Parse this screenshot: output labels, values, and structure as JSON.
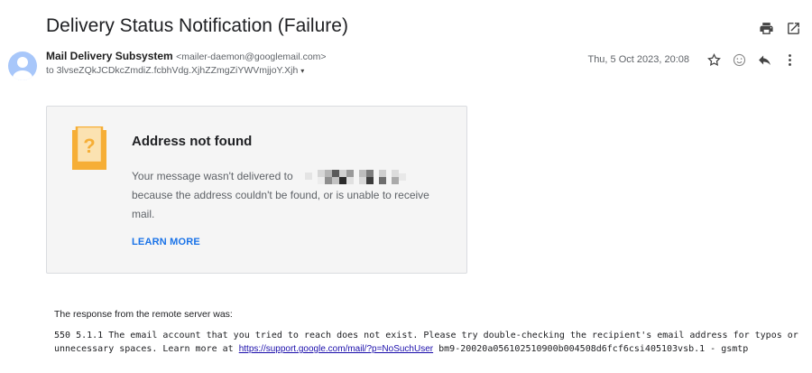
{
  "email": {
    "subject": "Delivery Status Notification (Failure)",
    "sender_name": "Mail Delivery Subsystem",
    "sender_email": "<mailer-daemon@googlemail.com>",
    "recipient": "to 3lvseZQkJCDkcZmdiZ.fcbhVdg.XjhZZmgZiYWVmjjoY.Xjh",
    "date": "Thu, 5 Oct 2023, 20:08"
  },
  "icons": {
    "print": "print-icon",
    "open_new": "open-in-new-window-icon",
    "star": "star-icon",
    "emoji": "emoji-react-icon",
    "reply": "reply-icon",
    "more": "more-vertical-icon",
    "recipient_caret": "▾"
  },
  "card": {
    "title": "Address not found",
    "message_prefix": "Your message wasn't delivered to",
    "message_suffix": "because the address couldn't be found, or is unable to receive mail.",
    "learn_more": "LEARN MORE",
    "accent_color": "#f6ae36"
  },
  "response": {
    "heading": "The response from the remote server was:",
    "line_before_link": "550 5.1.1 The email account that you tried to reach does not exist. Please try double-checking the recipient's email address for typos or unnecessary spaces. Learn more at",
    "link": "https://support.google.com/mail/?p=NoSuchUser",
    "line_after_link": "bm9-20020a056102510900b004508d6fcf6csi405103vsb.1 - gsmtp"
  }
}
